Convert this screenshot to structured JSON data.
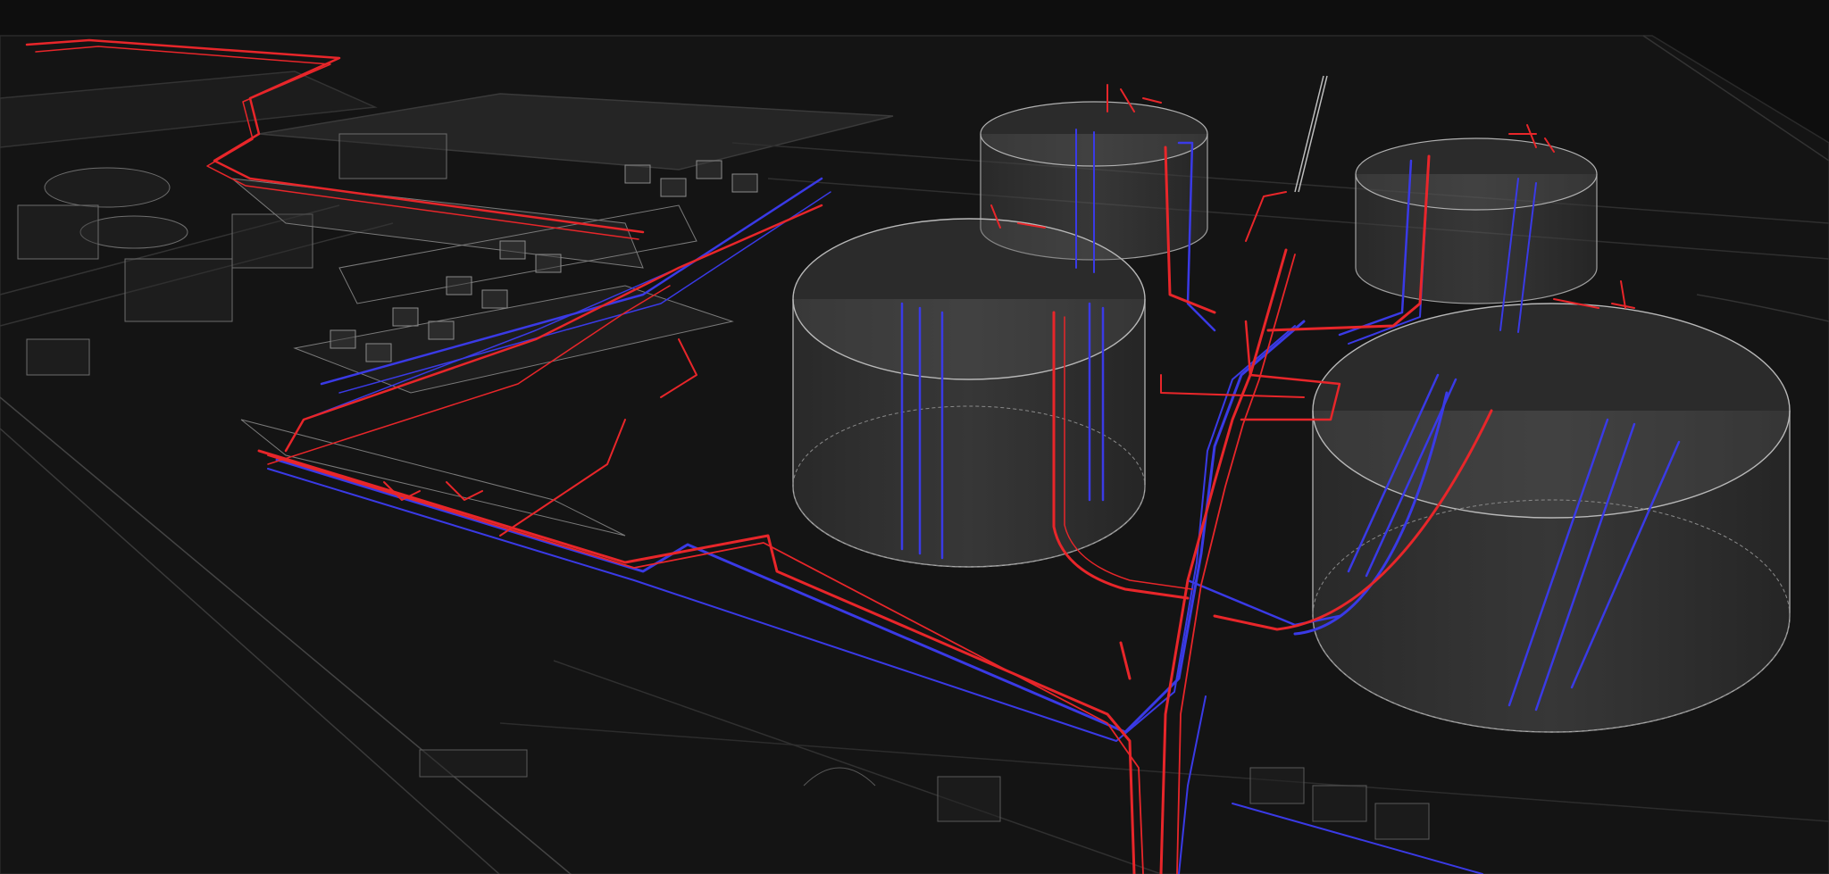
{
  "scene": {
    "view": "3d-wireframe",
    "colors": {
      "background": "#0e0e0e",
      "ground": "#161616",
      "structure": "#9a9a9a",
      "red_pipe": "#e8262a",
      "blue_pipe": "#3a3ae6"
    },
    "tanks": [
      {
        "name": "storage-tank-1"
      },
      {
        "name": "storage-tank-2"
      },
      {
        "name": "storage-tank-3"
      },
      {
        "name": "storage-tank-4"
      }
    ],
    "pipe_systems": [
      "red-pipe-network",
      "blue-pipe-network"
    ]
  }
}
